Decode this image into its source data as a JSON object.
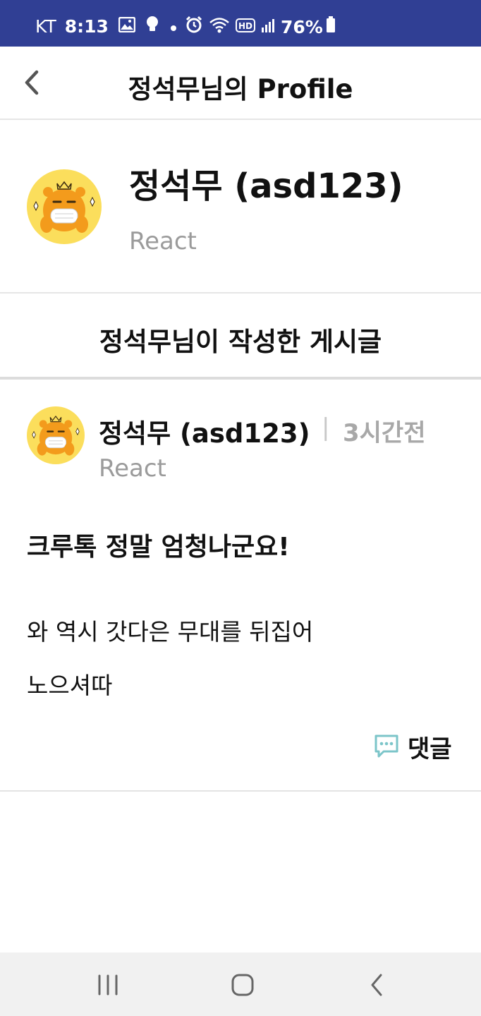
{
  "status_bar": {
    "carrier": "KT",
    "time": "8:13",
    "battery": "76%",
    "icons": [
      "image-icon",
      "bulb-icon",
      "dot-icon",
      "alarm-icon",
      "wifi-icon",
      "hd-icon",
      "signal-icon",
      "battery-icon"
    ]
  },
  "header": {
    "title": "정석무님의 Profile",
    "back_icon": "chevron-left-icon"
  },
  "profile": {
    "name": "정석무 (asd123)",
    "skill": "React",
    "avatar_icon": "ryan-mask-avatar"
  },
  "section": {
    "title": "정석무님이 작성한 게시글"
  },
  "post": {
    "author": "정석무 (asd123)",
    "separator": "|",
    "time": "3시간전",
    "skill": "React",
    "title": "크루톡 정말 엄청나군요!",
    "body_lines": [
      "와 역시 갓다은 무대를 뒤집어",
      "노으셔따"
    ],
    "comment_label": "댓글",
    "comment_icon": "chat-bubble-icon",
    "accent_color": "#7cc5c9"
  },
  "nav_bar": {
    "buttons": [
      "recents-icon",
      "home-icon",
      "back-icon"
    ]
  },
  "colors": {
    "status_bar_bg": "#303f94",
    "secondary_text": "#9b9b9b"
  }
}
